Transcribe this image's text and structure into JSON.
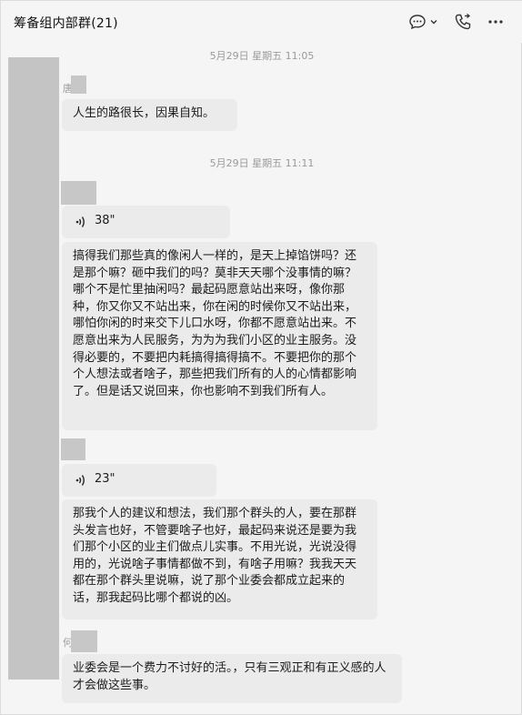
{
  "header": {
    "title": "筹备组内部群(21)",
    "icons": [
      "chat-bubble-icon",
      "chevron-down-icon",
      "phone-call-icon",
      "more-icon"
    ]
  },
  "messages": {
    "time1": "5月29日 星期五 11:05",
    "sender1": "唐",
    "text1": "人生的路很长，因果自知。",
    "time2": "5月29日 星期五 11:11",
    "voice1": "38\"",
    "text2": "搞得我们那些真的像闲人一样的，是天上掉馅饼吗？还是那个嘛？砸中我们的吗？莫非天天哪个没事情的嘛？哪个不是忙里抽闲吗？最起码愿意站出来呀，像你那种，你又你又不站出来，你在闲的时候你又不站出来，哪怕你闲的时来交下儿口水呀，你都不愿意站出来。不愿意出来为人民服务，为为为我们小区的业主服务。没得必要的，不要把内耗搞得搞得搞不。不要把你的那个个人想法或者啥子，那些把我们所有的人的心情都影响了。但是话又说回来，你也影响不到我们所有人。",
    "voice2": "23\"",
    "text3": "那我个人的建议和想法，我们那个群头的人，要在那群头发言也好，不管要啥子也好，最起码来说还是要为我们那个小区的业主们做点儿实事。不用光说，光说没得用的，光说啥子事情都做不到，有啥子用嘛？我我天天都在那个群头里说嘛，说了那个业委会都成立起来的话，那我起码比哪个都说的凶。",
    "sender4": "何",
    "text4": "业委会是一个费力不讨好的活。，只有三观正和有正义感的人才会做这些事。"
  }
}
